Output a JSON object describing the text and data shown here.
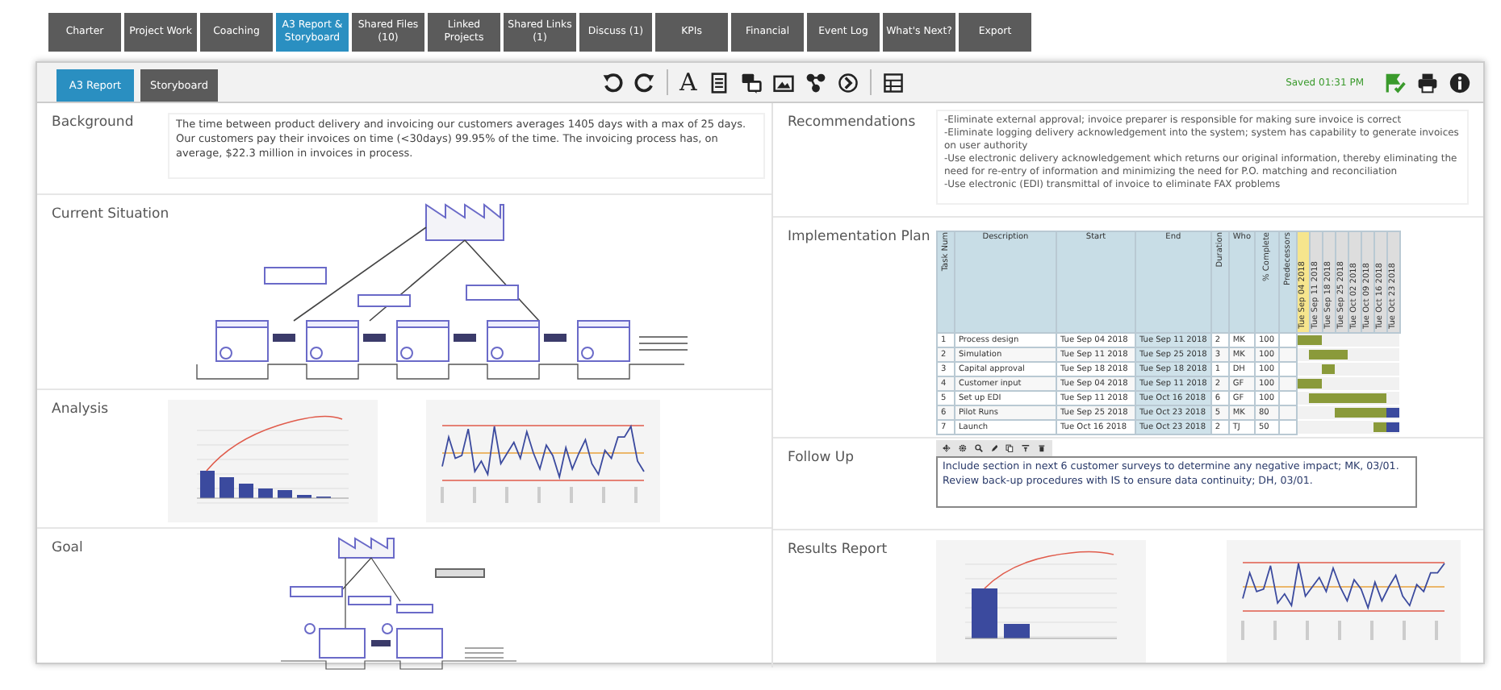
{
  "tabs": [
    {
      "label": "Charter",
      "selected": false
    },
    {
      "label": "Project Work",
      "selected": false
    },
    {
      "label": "Coaching",
      "selected": false
    },
    {
      "label": "A3 Report & Storyboard",
      "selected": true
    },
    {
      "label": "Shared Files (10)",
      "selected": false
    },
    {
      "label": "Linked Projects",
      "selected": false
    },
    {
      "label": "Shared Links (1)",
      "selected": false
    },
    {
      "label": "Discuss (1)",
      "selected": false
    },
    {
      "label": "KPIs",
      "selected": false
    },
    {
      "label": "Financial",
      "selected": false
    },
    {
      "label": "Event Log",
      "selected": false
    },
    {
      "label": "What's Next?",
      "selected": false
    },
    {
      "label": "Export",
      "selected": false
    }
  ],
  "subtabs": [
    {
      "label": "A3 Report",
      "selected": true
    },
    {
      "label": "Storyboard",
      "selected": false
    }
  ],
  "toolbar": {
    "text_tool": "A",
    "saved": "Saved 01:31 PM"
  },
  "left_sections": [
    {
      "heading": "Background",
      "kind": "text",
      "text": "The time between product delivery and invoicing our customers averages 1405 days with a max of 25 days.  Our customers pay their invoices on time (<30days)  99.95% of the time.  The invoicing process has, on average, $22.3 million in invoices in process."
    },
    {
      "heading": "Current Situation",
      "kind": "map"
    },
    {
      "heading": "Analysis",
      "kind": "charts"
    },
    {
      "heading": "Goal",
      "kind": "small_map"
    }
  ],
  "right_sections": [
    {
      "heading": "Recommendations",
      "kind": "list",
      "lines": [
        "-Eliminate external approval; invoice preparer is responsible for making sure invoice is correct",
        "-Eliminate logging delivery acknowledgement into the system; system has capability to generate invoices on user authority",
        "-Use electronic delivery acknowledgement which returns our original information, thereby eliminating the need for re-entry of information and minimizing the need for P.O. matching and reconciliation",
        "-Use electronic (EDI) transmittal of invoice to eliminate FAX problems"
      ]
    },
    {
      "heading": "Implementation Plan",
      "kind": "gantt"
    },
    {
      "heading": "Follow Up",
      "kind": "followup",
      "value": "Include section in next 6 customer surveys to determine any negative impact; MK, 03/01.\nReview back-up procedures with IS to ensure data continuity; DH, 03/01."
    },
    {
      "heading": "Results Report",
      "kind": "charts"
    }
  ],
  "gantt": {
    "columns": [
      "Task Num",
      "Description",
      "Start",
      "End",
      "Duration",
      "Who",
      "% Complete",
      "Predecessors"
    ],
    "dates": [
      {
        "label": "Tue Sep 04 2018",
        "highlighted": true
      },
      {
        "label": "Tue Sep 11 2018",
        "highlighted": false
      },
      {
        "label": "Tue Sep 18 2018",
        "highlighted": false
      },
      {
        "label": "Tue Sep 25 2018",
        "highlighted": false
      },
      {
        "label": "Tue Oct 02 2018",
        "highlighted": false
      },
      {
        "label": "Tue Oct 09 2018",
        "highlighted": false
      },
      {
        "label": "Tue Oct 16 2018",
        "highlighted": false
      },
      {
        "label": "Tue Oct 23 2018",
        "highlighted": false
      }
    ],
    "rows": [
      {
        "num": "1",
        "description": "Process design",
        "start": "Tue Sep 04 2018",
        "end": "Tue Sep 11 2018",
        "duration": "2",
        "who": "MK",
        "complete": "100",
        "timeline": [
          {
            "bar": true,
            "done": true
          },
          {
            "bar": true,
            "done": true
          },
          {
            "bar": false
          },
          {
            "bar": false
          },
          {
            "bar": false
          },
          {
            "bar": false
          },
          {
            "bar": false
          },
          {
            "bar": false
          }
        ]
      },
      {
        "num": "2",
        "description": "Simulation",
        "start": "Tue Sep 11 2018",
        "end": "Tue Sep 25 2018",
        "duration": "3",
        "who": "MK",
        "complete": "100",
        "timeline": [
          {
            "bar": false
          },
          {
            "bar": true,
            "done": true
          },
          {
            "bar": true,
            "done": true
          },
          {
            "bar": true,
            "done": true
          },
          {
            "bar": false
          },
          {
            "bar": false
          },
          {
            "bar": false
          },
          {
            "bar": false
          }
        ]
      },
      {
        "num": "3",
        "description": "Capital approval",
        "start": "Tue Sep 18 2018",
        "end": "Tue Sep 18 2018",
        "duration": "1",
        "who": "DH",
        "complete": "100",
        "timeline": [
          {
            "bar": false
          },
          {
            "bar": false
          },
          {
            "bar": true,
            "done": true
          },
          {
            "bar": false
          },
          {
            "bar": false
          },
          {
            "bar": false
          },
          {
            "bar": false
          },
          {
            "bar": false
          }
        ]
      },
      {
        "num": "4",
        "description": "Customer input",
        "start": "Tue Sep 04 2018",
        "end": "Tue Sep 11 2018",
        "duration": "2",
        "who": "GF",
        "complete": "100",
        "timeline": [
          {
            "bar": true,
            "done": true
          },
          {
            "bar": true,
            "done": true
          },
          {
            "bar": false
          },
          {
            "bar": false
          },
          {
            "bar": false
          },
          {
            "bar": false
          },
          {
            "bar": false
          },
          {
            "bar": false
          }
        ]
      },
      {
        "num": "5",
        "description": "Set up EDI",
        "start": "Tue Sep 11 2018",
        "end": "Tue Oct 16 2018",
        "duration": "6",
        "who": "GF",
        "complete": "100",
        "timeline": [
          {
            "bar": false
          },
          {
            "bar": true,
            "done": true
          },
          {
            "bar": true,
            "done": true
          },
          {
            "bar": true,
            "done": true
          },
          {
            "bar": true,
            "done": true
          },
          {
            "bar": true,
            "done": true
          },
          {
            "bar": true,
            "done": true
          },
          {
            "bar": false
          }
        ]
      },
      {
        "num": "6",
        "description": "Pilot Runs",
        "start": "Tue Sep 25 2018",
        "end": "Tue Oct 23 2018",
        "duration": "5",
        "who": "MK",
        "complete": "80",
        "timeline": [
          {
            "bar": false
          },
          {
            "bar": false
          },
          {
            "bar": false
          },
          {
            "bar": true,
            "done": true
          },
          {
            "bar": true,
            "done": true
          },
          {
            "bar": true,
            "done": true
          },
          {
            "bar": true,
            "done": true
          },
          {
            "bar": true,
            "done": false
          }
        ]
      },
      {
        "num": "7",
        "description": "Launch",
        "start": "Tue Oct 16 2018",
        "end": "Tue Oct 23 2018",
        "duration": "2",
        "who": "TJ",
        "complete": "50",
        "timeline": [
          {
            "bar": false
          },
          {
            "bar": false
          },
          {
            "bar": false
          },
          {
            "bar": false
          },
          {
            "bar": false
          },
          {
            "bar": false
          },
          {
            "bar": true,
            "done": true
          },
          {
            "bar": true,
            "done": false
          }
        ]
      }
    ]
  }
}
